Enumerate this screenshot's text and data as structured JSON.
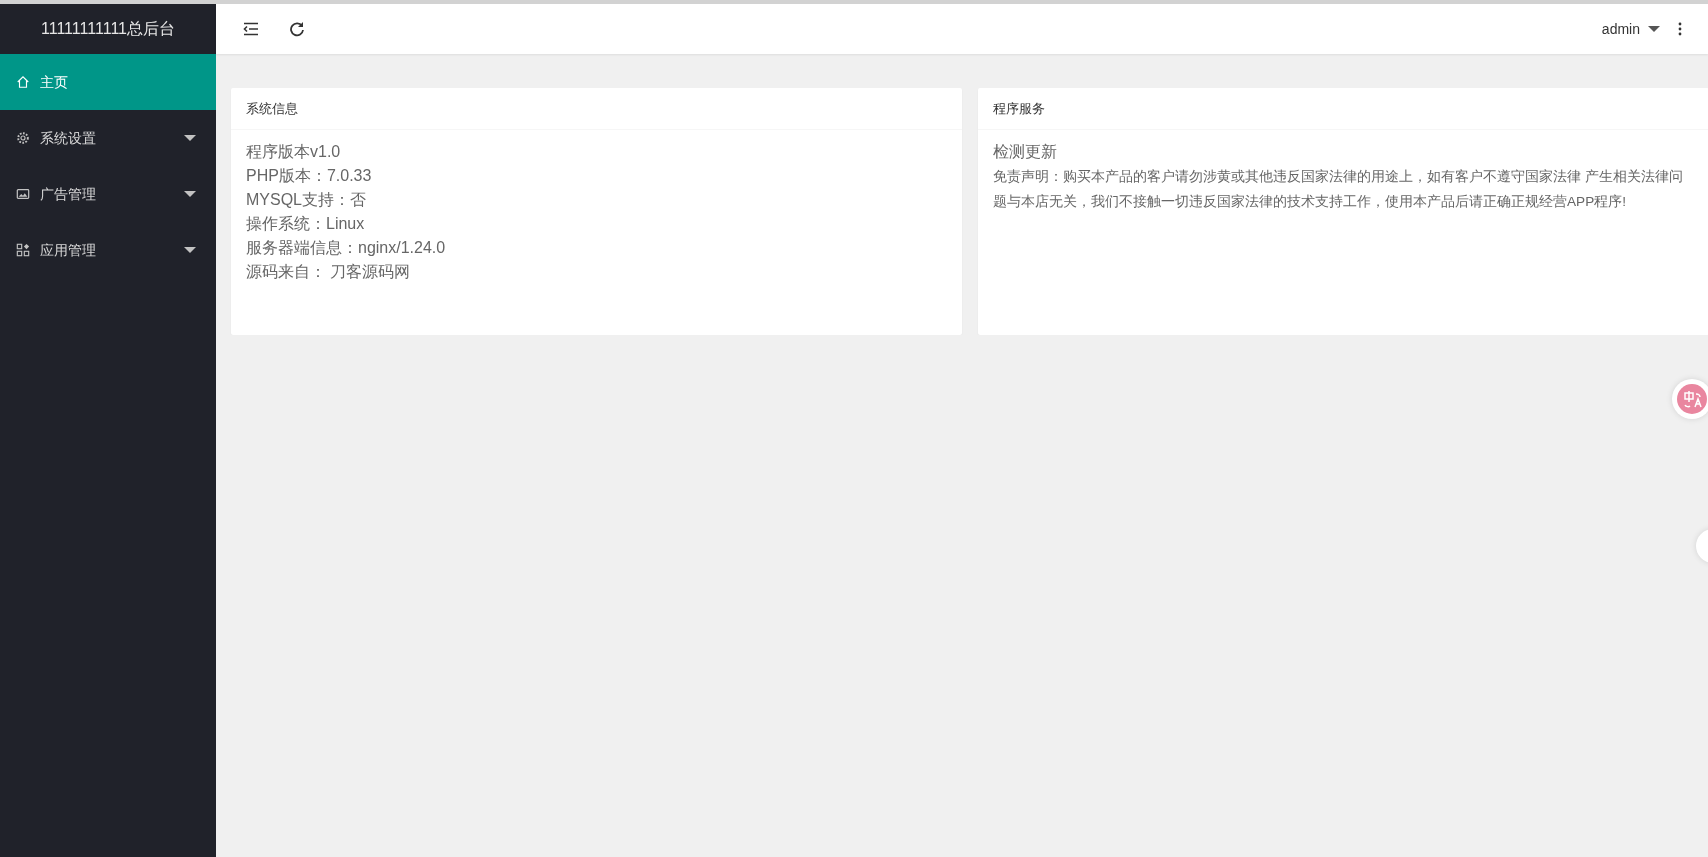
{
  "sidebar": {
    "brand": "11111111111总后台",
    "items": [
      {
        "label": "主页",
        "selected": true,
        "has_submenu": false
      },
      {
        "label": "系统设置",
        "selected": false,
        "has_submenu": true
      },
      {
        "label": "广告管理",
        "selected": false,
        "has_submenu": true
      },
      {
        "label": "应用管理",
        "selected": false,
        "has_submenu": true
      }
    ]
  },
  "header": {
    "user": "admin"
  },
  "cards": [
    {
      "title": "系统信息",
      "kind": "info",
      "lines": [
        "程序版本v1.0",
        "PHP版本：7.0.33",
        "MYSQL支持：否",
        "操作系统：Linux",
        "服务器端信息：nginx/1.24.0",
        "源码来自： 刀客源码网"
      ]
    },
    {
      "title": "程序服务",
      "kind": "service",
      "heading": "检测更新",
      "notice": "免责声明：购买本产品的客户请勿涉黄或其他违反国家法律的用途上，如有客户不遵守国家法律 产生相关法律问题与本店无关，我们不接触一切违反国家法律的技术支持工作，使用本产品后请正确正规经营APP程序!"
    }
  ]
}
